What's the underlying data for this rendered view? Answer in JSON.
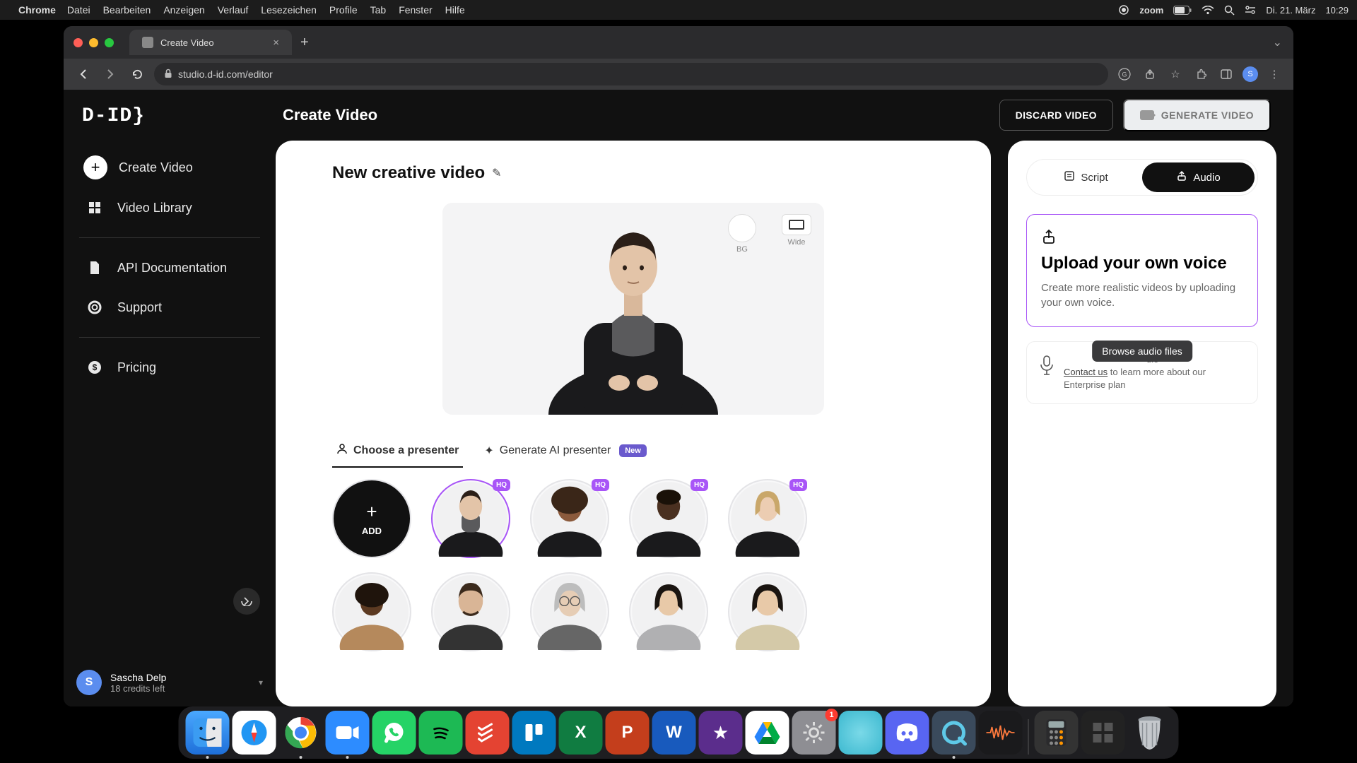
{
  "menubar": {
    "app": "Chrome",
    "items": [
      "Datei",
      "Bearbeiten",
      "Anzeigen",
      "Verlauf",
      "Lesezeichen",
      "Profile",
      "Tab",
      "Fenster",
      "Hilfe"
    ],
    "zoom": "zoom",
    "date": "Di. 21. März",
    "time": "10:29"
  },
  "browser": {
    "tab_title": "Create Video",
    "url": "studio.d-id.com/editor",
    "profile_initial": "S"
  },
  "sidebar": {
    "logo": "D-ID}",
    "items": {
      "create": "Create Video",
      "library": "Video Library",
      "api": "API Documentation",
      "support": "Support",
      "pricing": "Pricing"
    },
    "user": {
      "initial": "S",
      "name": "Sascha Delp",
      "credits": "18 credits left"
    }
  },
  "header": {
    "title": "Create Video",
    "discard": "DISCARD VIDEO",
    "generate": "GENERATE VIDEO"
  },
  "editor": {
    "video_name": "New creative video",
    "bg_label": "BG",
    "wide_label": "Wide",
    "tab_choose": "Choose a presenter",
    "tab_generate": "Generate AI presenter",
    "badge_new": "New",
    "add_label": "ADD",
    "hq": "HQ"
  },
  "panel": {
    "script": "Script",
    "audio": "Audio",
    "upload_title": "Upload your own voice",
    "upload_desc": "Create more realistic videos by uploading your own voice.",
    "tooltip": "Browse audio files",
    "clone_suffix": "dio",
    "contact": "Contact us",
    "clone_rest": " to learn more about our Enterprise plan"
  },
  "dock": {
    "badge_settings": "1"
  }
}
